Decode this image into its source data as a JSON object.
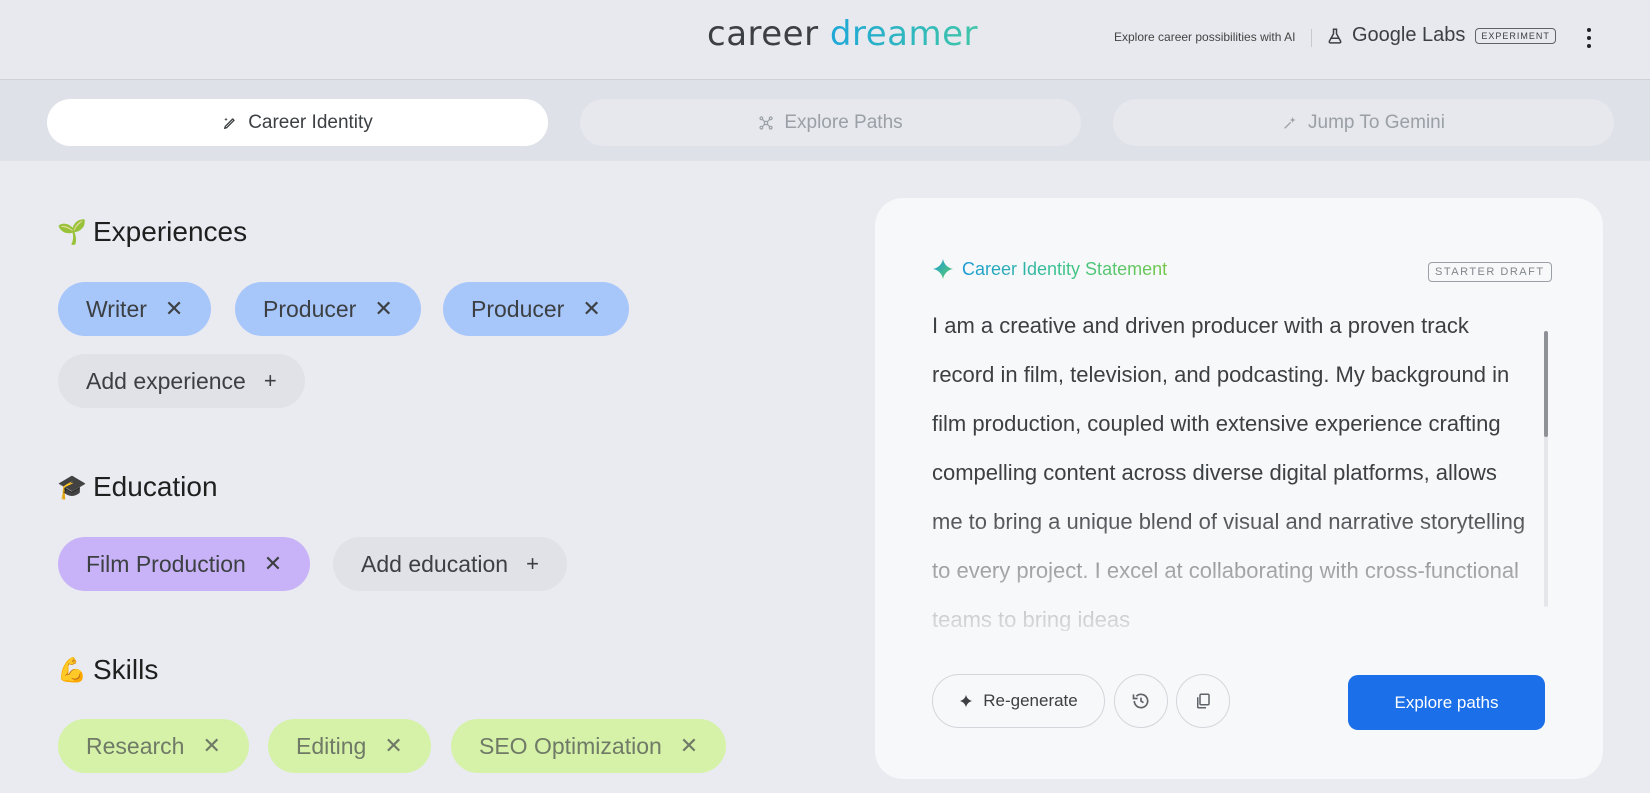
{
  "header": {
    "brand_part1": "career",
    "brand_part2": "dreamer",
    "tagline": "Explore career possibilities with AI",
    "labs_name": "Google Labs",
    "labs_badge": "EXPERIMENT",
    "menu_icon": "more-vert-icon"
  },
  "tabs": [
    {
      "label": "Career Identity",
      "icon": "edit-sparkle-icon",
      "active": true
    },
    {
      "label": "Explore Paths",
      "icon": "network-nodes-icon",
      "active": false
    },
    {
      "label": "Jump To Gemini",
      "icon": "sparkle-arrow-icon",
      "active": false
    }
  ],
  "experiences": {
    "emoji": "🌱",
    "title": "Experiences",
    "items": [
      "Writer",
      "Producer",
      "Producer"
    ],
    "add_label": "Add experience"
  },
  "education": {
    "emoji": "🎓",
    "title": "Education",
    "items": [
      "Film Production"
    ],
    "add_label": "Add education"
  },
  "skills": {
    "emoji": "💪",
    "title": "Skills",
    "items": [
      "Research",
      "Editing",
      "SEO Optimization"
    ]
  },
  "statement": {
    "title": "Career Identity Statement",
    "badge": "STARTER DRAFT",
    "text": "I am a creative and driven producer with a proven track record in film, television, and podcasting. My background in film production, coupled with extensive experience crafting compelling content across diverse digital platforms, allows me to bring a unique blend of visual and narrative storytelling to every project. I excel at collaborating with cross-functional teams to bring ideas",
    "regen_label": "Re-generate",
    "explore_label": "Explore paths"
  },
  "colors": {
    "primary_button": "#1b6fe8",
    "chip_experience": "#a7c6fa",
    "chip_education": "#c9b3f8",
    "chip_skill": "#d6f2a8",
    "chip_add": "#e1e2e7"
  }
}
